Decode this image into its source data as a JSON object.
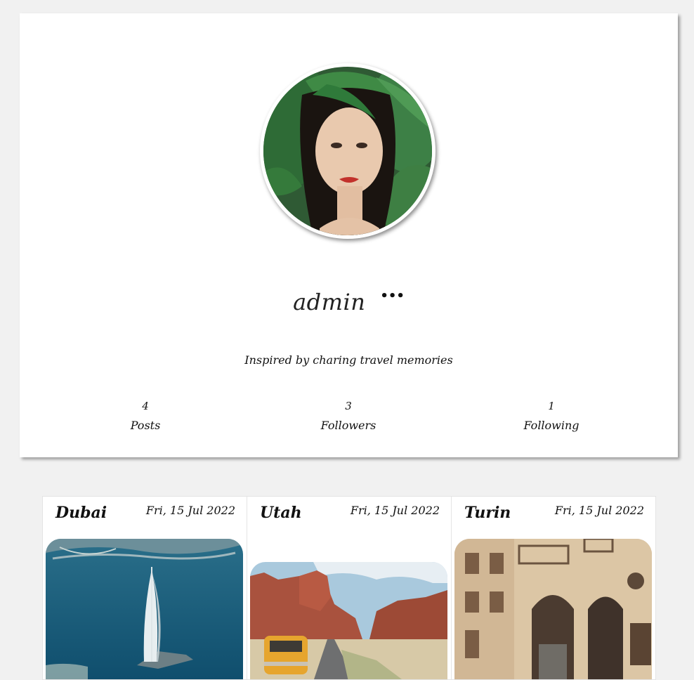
{
  "profile": {
    "username": "admin",
    "more_symbol": "•••",
    "bio": "Inspired by charing travel memories",
    "stats": {
      "posts": {
        "value": "4",
        "label": "Posts"
      },
      "followers": {
        "value": "3",
        "label": "Followers"
      },
      "following": {
        "value": "1",
        "label": "Following"
      }
    }
  },
  "posts": [
    {
      "title": "Dubai",
      "date": "Fri, 15 Jul 2022"
    },
    {
      "title": "Utah",
      "date": "Fri, 15 Jul 2022"
    },
    {
      "title": "Turin",
      "date": "Fri, 15 Jul 2022"
    }
  ]
}
